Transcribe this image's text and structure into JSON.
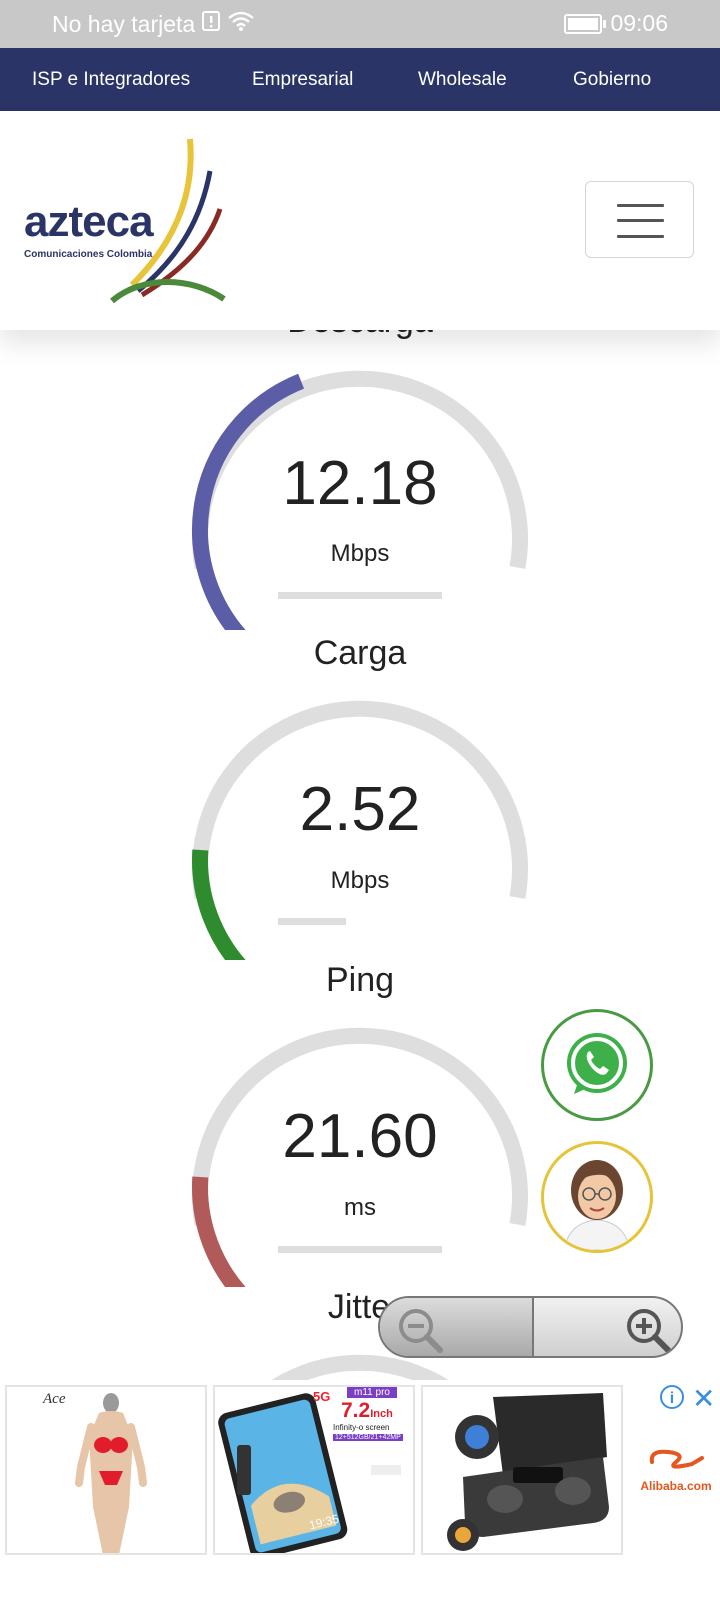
{
  "status_bar": {
    "carrier": "No hay tarjeta",
    "time": "09:06",
    "battery_level": 1.0,
    "icons": [
      "sim-alert-icon",
      "wifi-icon",
      "battery-icon"
    ]
  },
  "topnav": {
    "items": [
      {
        "label": "ISP e Integradores"
      },
      {
        "label": "Empresarial"
      },
      {
        "label": "Wholesale"
      },
      {
        "label": "Gobierno"
      }
    ]
  },
  "header": {
    "logo_word": "azteca",
    "logo_sub": "Comunicaciones Colombia",
    "menu_icon": "hamburger-icon"
  },
  "gauges": [
    {
      "label": "Descarga",
      "value": "12.18",
      "unit": "Mbps",
      "fill_fraction": 0.42,
      "color": "#5b5ea6"
    },
    {
      "label": "Carga",
      "value": "2.52",
      "unit": "Mbps",
      "fill_fraction": 0.18,
      "color": "#2e8b2e"
    },
    {
      "label": "Ping",
      "value": "21.60",
      "unit": "ms",
      "fill_fraction": 0.18,
      "color": "#b05a5a"
    },
    {
      "label": "Jitte",
      "value": "",
      "unit": "",
      "fill_fraction": 0.0,
      "color": "#cccccc"
    }
  ],
  "floating": {
    "whatsapp_icon": "whatsapp-icon",
    "agent_icon": "support-agent-avatar"
  },
  "zoom": {
    "out_icon": "zoom-out-icon",
    "in_icon": "zoom-in-icon"
  },
  "ads": {
    "items": [
      {
        "brand": "Ace",
        "icon": "swimsuit-product-image"
      },
      {
        "badge_5g": "5G",
        "model": "m11 pro",
        "screen": "7.2",
        "screen_unit": "Inch",
        "subtitle": "Infinity-o screen",
        "specs": "12+512GB/21+42MP",
        "clock": "19:35",
        "icon": "smartphone-product-image"
      },
      {
        "icon": "earbuds-product-image"
      }
    ],
    "info_icon": "info-icon",
    "close_icon": "close-icon",
    "advertiser": "Alibaba.com"
  },
  "colors": {
    "nav_bg": "#2a3466",
    "download": "#5b5ea6",
    "upload": "#2e8b2e",
    "ping": "#b05a5a",
    "track": "#dedede"
  }
}
